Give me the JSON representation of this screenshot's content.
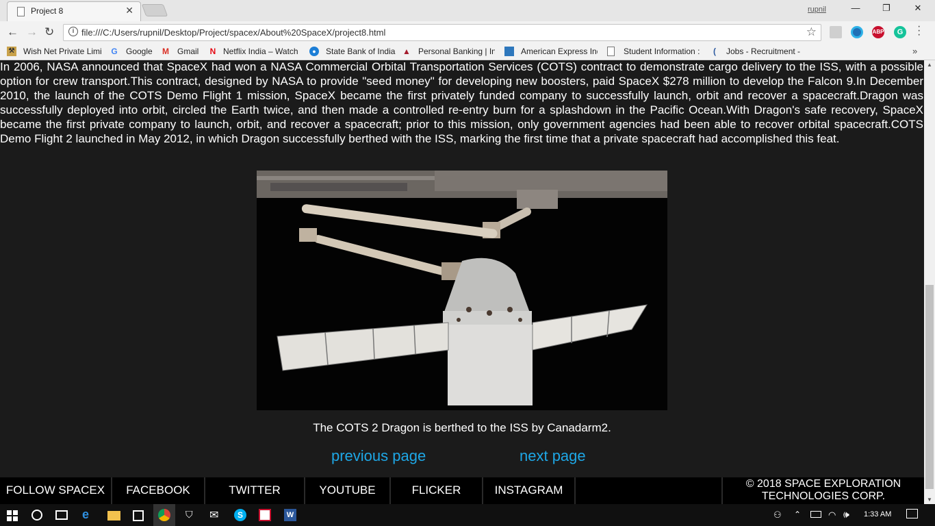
{
  "browser": {
    "tab_title": "Project 8",
    "tab_close": "✕",
    "user_name": "rupnil",
    "url": "file:///C:/Users/rupnil/Desktop/Project/spacex/About%20SpaceX/project8.html",
    "window_controls": [
      "—",
      "❐",
      "✕"
    ],
    "nav": {
      "back": "←",
      "forward": "→",
      "reload": "↻",
      "info": "i",
      "star": "☆"
    },
    "extensions": [
      "ABP",
      "G"
    ],
    "bookmarks": [
      {
        "icon": "app-icon",
        "label": "Wish Net Private Limi"
      },
      {
        "icon": "google-icon",
        "label": "Google"
      },
      {
        "icon": "gmail-icon",
        "label": "Gmail"
      },
      {
        "icon": "netflix-icon",
        "label": "Netflix India – Watch"
      },
      {
        "icon": "sbi-icon",
        "label": "State Bank of India"
      },
      {
        "icon": "bank-icon",
        "label": "Personal Banking | Int"
      },
      {
        "icon": "amex-icon",
        "label": "American Express Ind"
      },
      {
        "icon": "page-icon",
        "label": "Student Information :"
      },
      {
        "icon": "jobs-icon",
        "label": "Jobs - Recruitment - ."
      }
    ],
    "bookmarks_more": "»"
  },
  "page": {
    "article_text": "In 2006, NASA announced that SpaceX had won a NASA Commercial Orbital Transportation Services (COTS) contract to demonstrate cargo delivery to the ISS, with a possible option for crew transport.This contract, designed by NASA to provide \"seed money\" for developing new boosters, paid SpaceX $278 million to develop the Falcon 9.In December 2010, the launch of the COTS Demo Flight 1 mission, SpaceX became the first privately funded company to successfully launch, orbit and recover a spacecraft.Dragon was successfully deployed into orbit, circled the Earth twice, and then made a controlled re-entry burn for a splashdown in the Pacific Ocean.With Dragon's safe recovery, SpaceX became the first private company to launch, orbit, and recover a spacecraft; prior to this mission, only government agencies had been able to recover orbital spacecraft.COTS Demo Flight 2 launched in May 2012, in which Dragon successfully berthed with the ISS, marking the first time that a private spacecraft had accomplished this feat.",
    "figure_caption": "The COTS 2 Dragon is berthed to the ISS by Canadarm2.",
    "previous_link": "previous page",
    "next_link": "next page",
    "footer": {
      "follow_label": "FOLLOW SPACEX",
      "links": [
        "FACEBOOK",
        "TWITTER",
        "YOUTUBE",
        "FLICKER",
        "INSTAGRAM"
      ],
      "copyright_line1": "© 2018 SPACE EXPLORATION",
      "copyright_line2": "TECHNOLOGIES CORP."
    },
    "link_color": "#1ea7e6",
    "background_color": "#1b1b1b"
  },
  "taskbar": {
    "time": "1:33 AM",
    "pinned": [
      "start-icon",
      "cortana-icon",
      "task-view-icon",
      "edge-icon",
      "file-explorer-icon",
      "store-icon",
      "chrome-icon",
      "shield-icon",
      "mail-icon",
      "skype-icon",
      "acrobat-icon",
      "word-icon"
    ]
  }
}
